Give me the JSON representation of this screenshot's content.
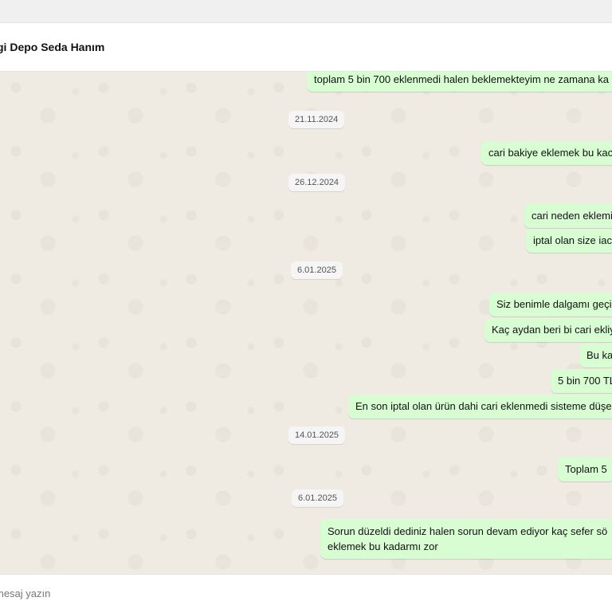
{
  "header": {
    "title": "gi Depo Seda Hanım"
  },
  "messages": [
    "toplam 5 bin 700 eklenmedi halen beklemekteyim ne zamana ka",
    "cari bakiye eklemek bu kac",
    "cari neden eklemi",
    "iptal olan size iac",
    "Siz benimle dalgamı geçi",
    "Kaç aydan beri bi cari ekliy",
    "Bu ka",
    "5 bin 700 TL",
    "En son iptal olan ürün dahi cari eklenmedi sisteme düşe",
    "Toplam 5",
    "Sorun düzeldi dediniz halen sorun devam ediyor kaç sefer sö eklemek bu kadarmı zor"
  ],
  "dates": [
    "21.11.2024",
    "26.12.2024",
    "6.01.2025",
    "14.01.2025",
    "6.01.2025"
  ],
  "composer": {
    "placeholder": "mesaj yazın"
  }
}
